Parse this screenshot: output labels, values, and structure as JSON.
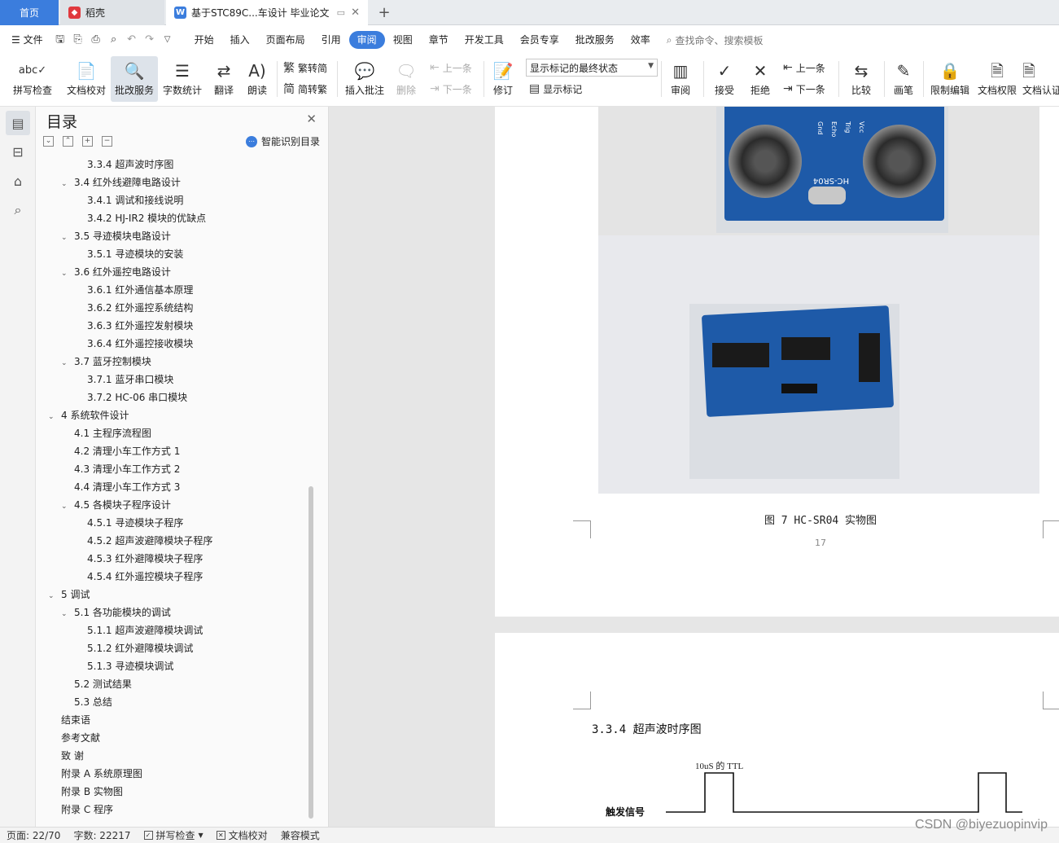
{
  "tabs": {
    "home": "首页",
    "daoke": "稻壳",
    "doc": "基于STC89C...车设计 毕业论文",
    "new_tab": "+"
  },
  "menu": {
    "file": "文件",
    "items": [
      "开始",
      "插入",
      "页面布局",
      "引用",
      "审阅",
      "视图",
      "章节",
      "开发工具",
      "会员专享",
      "批改服务",
      "效率"
    ],
    "active": "审阅",
    "search_placeholder": "查找命令、搜索模板"
  },
  "ribbon": {
    "spell_check": "拼写检查",
    "doc_proof": "文档校对",
    "revise_service": "批改服务",
    "word_count": "字数统计",
    "translate": "翻译",
    "read_aloud": "朗读",
    "trad_to_simp": "繁转简",
    "simp_to_trad": "简转繁",
    "insert_comment": "插入批注",
    "delete": "删除",
    "prev_comment": "上一条",
    "next_comment": "下一条",
    "track_changes": "修订",
    "markup_state": "显示标记的最终状态",
    "show_markup": "显示标记",
    "review": "审阅",
    "accept": "接受",
    "reject": "拒绝",
    "prev_change": "上一条",
    "next_change": "下一条",
    "compare": "比较",
    "pen": "画笔",
    "restrict_edit": "限制编辑",
    "doc_permission": "文档权限",
    "doc_cert": "文档认证"
  },
  "toc": {
    "title": "目录",
    "smart_toc": "智能识别目录",
    "items": [
      {
        "text": "3.3.4  超声波时序图",
        "level": 3,
        "chev": false
      },
      {
        "text": "3.4  红外线避障电路设计",
        "level": 2,
        "chev": true
      },
      {
        "text": "3.4.1  调试和接线说明",
        "level": 3,
        "chev": false
      },
      {
        "text": "3.4.2 HJ-IR2 模块的优缺点",
        "level": 3,
        "chev": false
      },
      {
        "text": "3.5  寻迹模块电路设计",
        "level": 2,
        "chev": true
      },
      {
        "text": "3.5.1  寻迹模块的安装",
        "level": 3,
        "chev": false
      },
      {
        "text": "3.6  红外遥控电路设计",
        "level": 2,
        "chev": true
      },
      {
        "text": "3.6.1  红外通信基本原理",
        "level": 3,
        "chev": false
      },
      {
        "text": "3.6.2  红外遥控系统结构",
        "level": 3,
        "chev": false
      },
      {
        "text": "3.6.3  红外遥控发射模块",
        "level": 3,
        "chev": false
      },
      {
        "text": "3.6.4  红外遥控接收模块",
        "level": 3,
        "chev": false
      },
      {
        "text": "3.7  蓝牙控制模块",
        "level": 2,
        "chev": true
      },
      {
        "text": "3.7.1  蓝牙串口模块",
        "level": 3,
        "chev": false
      },
      {
        "text": "3.7.2 HC-06 串口模块",
        "level": 3,
        "chev": false
      },
      {
        "text": "4  系统软件设计",
        "level": 1,
        "chev": true
      },
      {
        "text": "4.1  主程序流程图",
        "level": 2,
        "chev": false
      },
      {
        "text": "4.2  清理小车工作方式 1",
        "level": 2,
        "chev": false
      },
      {
        "text": "4.3  清理小车工作方式 2",
        "level": 2,
        "chev": false
      },
      {
        "text": "4.4  清理小车工作方式 3",
        "level": 2,
        "chev": false
      },
      {
        "text": "4.5  各模块子程序设计",
        "level": 2,
        "chev": true
      },
      {
        "text": "4.5.1  寻迹模块子程序",
        "level": 3,
        "chev": false
      },
      {
        "text": "4.5.2  超声波避障模块子程序",
        "level": 3,
        "chev": false
      },
      {
        "text": "4.5.3  红外避障模块子程序",
        "level": 3,
        "chev": false
      },
      {
        "text": "4.5.4  红外遥控模块子程序",
        "level": 3,
        "chev": false
      },
      {
        "text": "5  调试",
        "level": 1,
        "chev": true
      },
      {
        "text": "5.1  各功能模块的调试",
        "level": 2,
        "chev": true
      },
      {
        "text": "5.1.1  超声波避障模块调试",
        "level": 3,
        "chev": false
      },
      {
        "text": "5.1.2  红外避障模块调试",
        "level": 3,
        "chev": false
      },
      {
        "text": "5.1.3  寻迹模块调试",
        "level": 3,
        "chev": false
      },
      {
        "text": "5.2  测试结果",
        "level": 2,
        "chev": false
      },
      {
        "text": "5.3  总结",
        "level": 2,
        "chev": false
      },
      {
        "text": "结束语",
        "level": 0,
        "chev": false
      },
      {
        "text": "参考文献",
        "level": 0,
        "chev": false
      },
      {
        "text": "致    谢",
        "level": 0,
        "chev": false
      },
      {
        "text": "附录 A    系统原理图",
        "level": 0,
        "chev": false
      },
      {
        "text": "附录 B    实物图",
        "level": 0,
        "chev": false
      },
      {
        "text": "附录 C    程序",
        "level": 0,
        "chev": false
      }
    ]
  },
  "document": {
    "module_label": "HC-SR04",
    "pin_labels": [
      "Gnd",
      "Echo",
      "Trig",
      "Vcc"
    ],
    "caption": "图 7  HC-SR04 实物图",
    "page_number": "17",
    "section_title": "3.3.4  超声波时序图",
    "timing_pulse_label": "10uS 的 TTL",
    "timing_signal_label": "触发信号"
  },
  "status": {
    "page": "页面: 22/70",
    "words": "字数: 22217",
    "spell_check": "拼写检查",
    "doc_proof": "文档校对",
    "compat_mode": "兼容模式"
  },
  "watermark": "CSDN @biyezuopinvip"
}
